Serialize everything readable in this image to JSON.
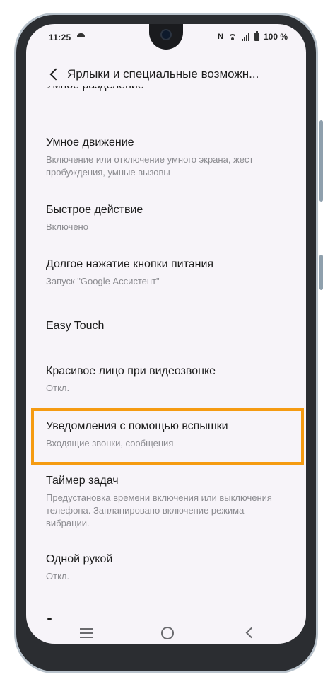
{
  "status_bar": {
    "time": "11:25",
    "nfc": "N",
    "battery_percent": "100 %"
  },
  "header": {
    "title": "Ярлыки и специальные возможн..."
  },
  "list": {
    "partial_top_title": "Умное разделение",
    "items": [
      {
        "title": "Умное движение",
        "subtitle": "Включение или отключение умного экрана, жест пробуждения, умные вызовы"
      },
      {
        "title": "Быстрое действие",
        "subtitle": "Включено"
      },
      {
        "title": "Долгое нажатие кнопки питания",
        "subtitle": "Запуск \"Google Ассистент\""
      },
      {
        "title": "Easy Touch",
        "subtitle": ""
      },
      {
        "title": "Красивое лицо при видеозвонке",
        "subtitle": "Откл."
      },
      {
        "title": "Уведомления с помощью вспышки",
        "subtitle": "Входящие звонки, сообщения"
      },
      {
        "title": "Таймер задач",
        "subtitle": "Предустановка времени включения или выключения телефона. Запланировано включение режима вибрации."
      },
      {
        "title": "Одной рукой",
        "subtitle": "Откл."
      }
    ]
  },
  "highlight": {
    "color": "#f59b12",
    "target_item": "Уведомления с помощью вспышки"
  },
  "icons": {
    "back": "chevron-left-icon",
    "nav_recents": "menu-lines-icon",
    "nav_home": "circle-home-icon",
    "nav_back": "chevron-left-icon"
  }
}
